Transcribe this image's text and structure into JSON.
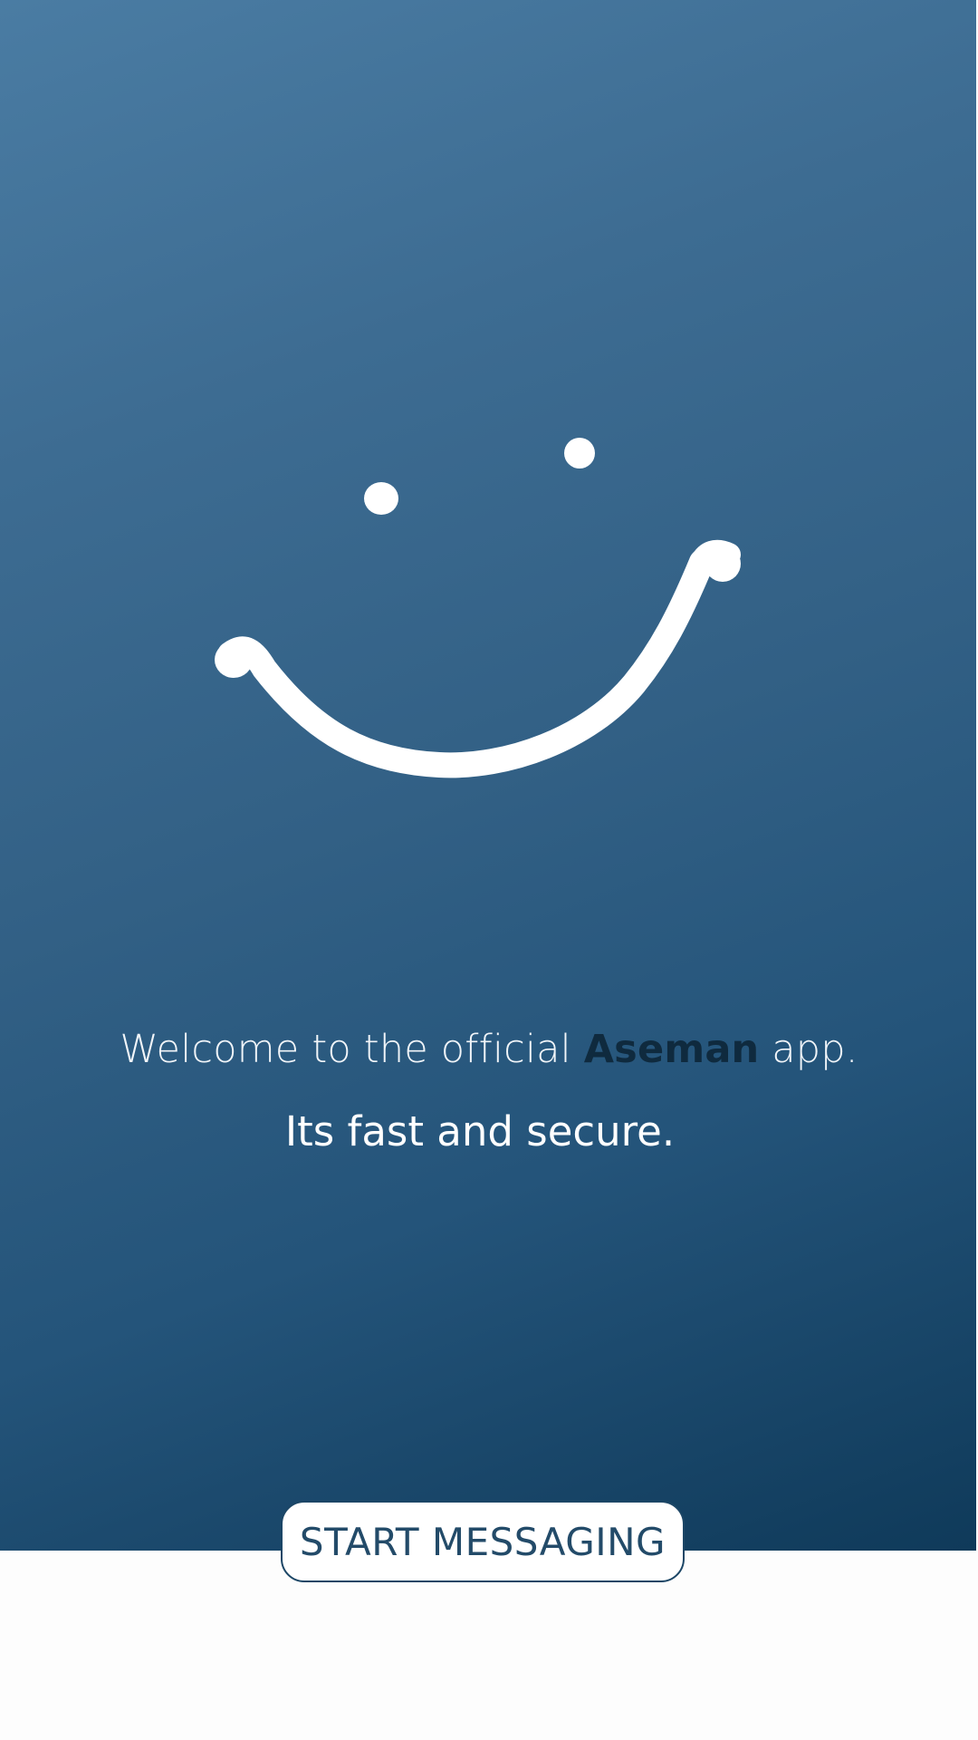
{
  "intro": {
    "welcome_prefix": "Welcome to the official ",
    "brand_name": "Aseman",
    "welcome_suffix": " app.",
    "tagline": "Its fast and secure."
  },
  "actions": {
    "start_label": "START MESSAGING"
  },
  "illustration": {
    "icon": "smiley-face-icon"
  },
  "colors": {
    "gradient_top": "#4a7ca3",
    "gradient_bottom": "#0f3a5a",
    "brand_text": "#0f2a3e",
    "button_text": "#234b69"
  }
}
